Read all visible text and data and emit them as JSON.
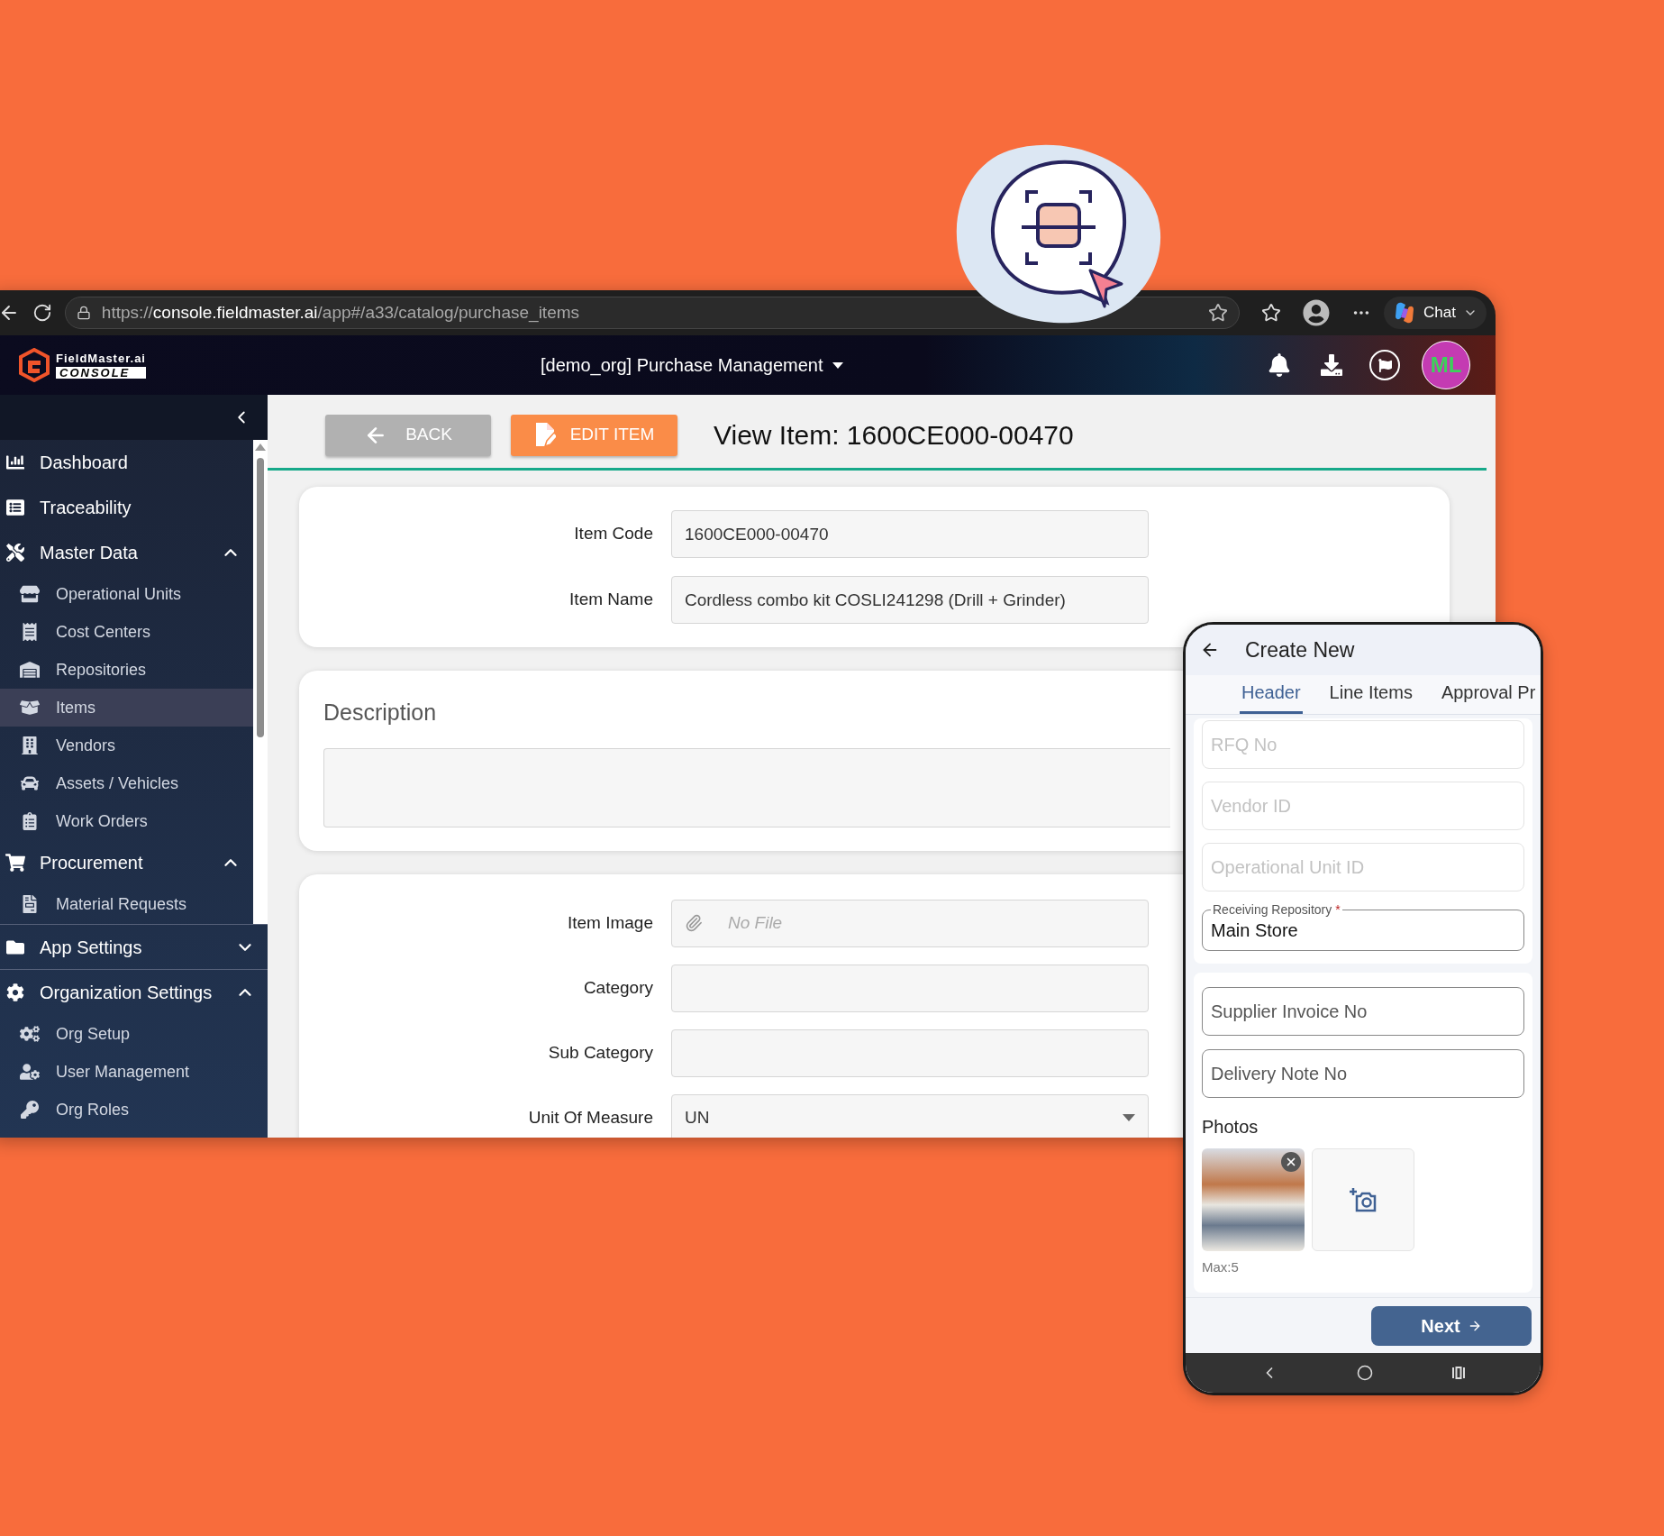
{
  "browser": {
    "url": {
      "scheme": "https://",
      "host": "console.fieldmaster.ai",
      "path": "/app#/a33/catalog/purchase_items"
    },
    "chat_label": "Chat"
  },
  "app_header": {
    "logo_name": "FieldMaster.ai",
    "logo_sub": "CONSOLE",
    "module": "[demo_org] Purchase Management",
    "avatar": "ML"
  },
  "toolbar": {
    "back": "BACK",
    "edit": "EDIT ITEM",
    "title": "View Item: 1600CE000-00470"
  },
  "sidebar": {
    "nav": [
      {
        "label": "Dashboard",
        "kind": "item",
        "selected": false
      },
      {
        "label": "Traceability",
        "kind": "item",
        "selected": false
      },
      {
        "label": "Master Data",
        "kind": "group",
        "expanded": true,
        "selected": false,
        "children": [
          {
            "label": "Operational Units",
            "selected": false
          },
          {
            "label": "Cost Centers",
            "selected": false
          },
          {
            "label": "Repositories",
            "selected": false
          },
          {
            "label": "Items",
            "selected": true
          },
          {
            "label": "Vendors",
            "selected": false
          },
          {
            "label": "Assets / Vehicles",
            "selected": false
          },
          {
            "label": "Work Orders",
            "selected": false
          }
        ]
      },
      {
        "label": "Procurement",
        "kind": "group",
        "expanded": true,
        "selected": false,
        "children": [
          {
            "label": "Material Requests",
            "selected": false
          }
        ]
      }
    ],
    "settings": [
      {
        "label": "App Settings",
        "kind": "group",
        "expanded": false,
        "selected": false
      },
      {
        "label": "Organization Settings",
        "kind": "group",
        "expanded": true,
        "selected": false,
        "children": [
          {
            "label": "Org Setup",
            "selected": false
          },
          {
            "label": "User Management",
            "selected": false
          },
          {
            "label": "Org Roles",
            "selected": false
          }
        ]
      }
    ]
  },
  "form": {
    "identity": [
      {
        "label": "Item Code",
        "kind": "text",
        "value": "1600CE000-00470"
      },
      {
        "label": "Item Name",
        "kind": "text",
        "value": "Cordless combo kit COSLI241298 (Drill + Grinder)"
      }
    ],
    "description": {
      "title": "Description"
    },
    "details": [
      {
        "label": "Item Image",
        "kind": "file",
        "placeholder": "No File"
      },
      {
        "label": "Category",
        "kind": "text"
      },
      {
        "label": "Sub Category",
        "kind": "text"
      },
      {
        "label": "Unit Of Measure",
        "kind": "select",
        "value": "UN"
      }
    ]
  },
  "phone": {
    "title": "Create New",
    "tabs": [
      {
        "label": "Header",
        "selected": true
      },
      {
        "label": "Line Items",
        "selected": false
      },
      {
        "label": "Approval Pr",
        "selected": false
      }
    ],
    "header_fields": [
      {
        "placeholder": "RFQ No",
        "disabled": true
      },
      {
        "placeholder": "Vendor ID",
        "disabled": true
      },
      {
        "placeholder": "Operational Unit ID",
        "disabled": true
      },
      {
        "label": "Receiving Repository",
        "required_mark": "*",
        "value": "Main Store",
        "disabled": false
      }
    ],
    "doc_fields": [
      {
        "placeholder": "Supplier Invoice No",
        "disabled": false
      },
      {
        "placeholder": "Delivery Note No",
        "disabled": false
      }
    ],
    "photos_label": "Photos",
    "photos": [
      {
        "kind": "photo"
      }
    ],
    "photos_hint": "Max:5",
    "next": "Next"
  }
}
